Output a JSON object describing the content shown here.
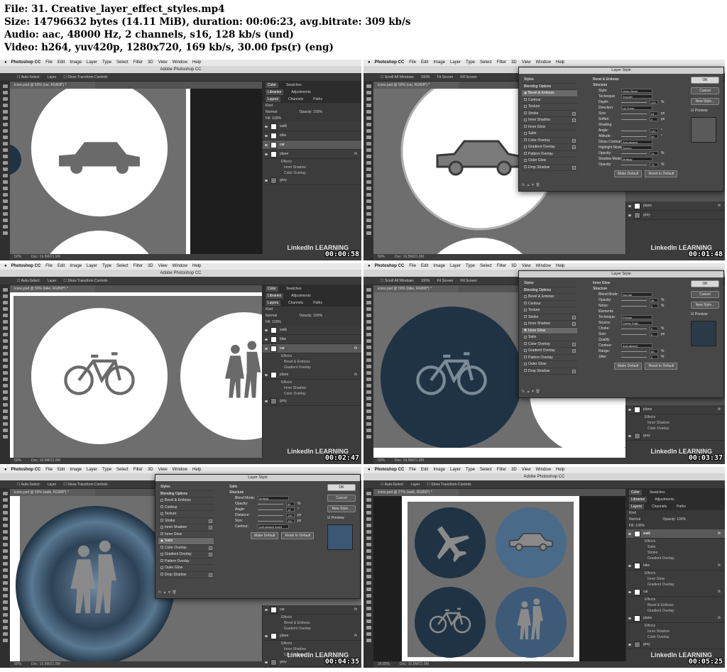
{
  "header": {
    "file": "File: 31. Creative_layer_effect_styles.mp4",
    "size": "Size: 14796632 bytes (14.11 MiB), duration: 00:06:23, avg.bitrate: 309 kb/s",
    "audio": "Audio: aac, 48000 Hz, 2 channels, s16, 128 kb/s (und)",
    "video": "Video: h264, yuv420p, 1280x720, 169 kb/s, 30.00 fps(r) (eng)"
  },
  "app": {
    "menus": [
      "Photoshop CC",
      "File",
      "Edit",
      "Image",
      "Layer",
      "Type",
      "Select",
      "Filter",
      "3D",
      "View",
      "Window",
      "Help"
    ],
    "window_title": "Adobe Photoshop CC",
    "auto_select": "Auto-Select:",
    "layer_dropdown": "Layer",
    "show_transform": "Show Transform Controls",
    "scroll_all": "Scroll All Windows",
    "fit_screen": "Fit Screen",
    "fill_screen": "Fill Screen",
    "zoom_label": "100%",
    "doc_size": "Doc: 16.5M/21.9M",
    "watermark": "LinkedIn LEARNING"
  },
  "panel": {
    "tabs_top": [
      "Color",
      "Swatches"
    ],
    "tabs_mid": [
      "Libraries",
      "Adjustments"
    ],
    "tabs_layers": [
      "Layers",
      "Channels",
      "Paths"
    ],
    "kind": "Kind",
    "blend": "Normal",
    "opacity": "Opacity: 100%",
    "fill": "Fill: 100%",
    "fx": "fx"
  },
  "frames": [
    {
      "timestamp": "00:00:58",
      "doc_tab": "icons.psd @ 50% (car, RGB/8*) *",
      "zoom": "50%",
      "layers": [
        {
          "name": "walk",
          "thumb": "white",
          "selected": false,
          "fx": false,
          "subs": []
        },
        {
          "name": "bike",
          "thumb": "white",
          "selected": false,
          "fx": false,
          "subs": []
        },
        {
          "name": "car",
          "thumb": "white",
          "selected": true,
          "fx": false,
          "subs": []
        },
        {
          "name": "plane",
          "thumb": "white",
          "selected": false,
          "fx": true,
          "subs": [
            "Effects",
            "Inner Shadow",
            "Color Overlay"
          ]
        },
        {
          "name": "grey",
          "thumb": "grey",
          "selected": false,
          "fx": false,
          "subs": []
        }
      ]
    },
    {
      "timestamp": "00:01:48",
      "doc_tab": "icons.psd @ 50% (car, RGB/8*) *",
      "zoom": "50%",
      "layers": [
        {
          "name": "plane",
          "thumb": "white",
          "selected": false,
          "fx": true,
          "subs": []
        },
        {
          "name": "grey",
          "thumb": "grey",
          "selected": false,
          "fx": false,
          "subs": []
        }
      ],
      "dialog": {
        "title": "Layer Style",
        "section": "Bevel & Emboss",
        "subsection": "Structure",
        "rows": [
          {
            "label": "Style:",
            "value": "Outer Bevel",
            "unit": ""
          },
          {
            "label": "Technique:",
            "value": "Smooth",
            "unit": ""
          },
          {
            "label": "Depth:",
            "value": "100",
            "unit": "%"
          },
          {
            "label": "Direction:",
            "value": "Up  Down",
            "unit": ""
          },
          {
            "label": "Size:",
            "value": "24",
            "unit": "px"
          },
          {
            "label": "Soften:",
            "value": "0",
            "unit": "px"
          },
          {
            "label": "Shading",
            "value": "",
            "unit": ""
          },
          {
            "label": "Angle:",
            "value": "141",
            "unit": "°"
          },
          {
            "label": "Altitude:",
            "value": "30",
            "unit": "°"
          },
          {
            "label": "Gloss Contour:",
            "value": "Anti-aliased",
            "unit": ""
          },
          {
            "label": "Highlight Mode:",
            "value": "Screen",
            "unit": ""
          },
          {
            "label": "Opacity:",
            "value": "75",
            "unit": "%"
          },
          {
            "label": "Shadow Mode:",
            "value": "Multiply",
            "unit": ""
          },
          {
            "label": "Opacity:",
            "value": "75",
            "unit": "%"
          }
        ],
        "buttons": [
          "Make Default",
          "Reset to Default"
        ],
        "side_buttons": [
          "OK",
          "Cancel",
          "New Style..."
        ],
        "preview": "Preview",
        "swatch_color": "#5a5a5a"
      }
    },
    {
      "timestamp": "00:02:47",
      "doc_tab": "icons.psd @ 50% (bike, RGB/8*) *",
      "zoom": "50%",
      "layers": [
        {
          "name": "walk",
          "thumb": "white",
          "selected": false,
          "fx": false,
          "subs": []
        },
        {
          "name": "bike",
          "thumb": "white",
          "selected": false,
          "fx": false,
          "subs": []
        },
        {
          "name": "car",
          "thumb": "white",
          "selected": true,
          "fx": true,
          "subs": [
            "Effects",
            "Bevel & Emboss",
            "Gradient Overlay"
          ]
        },
        {
          "name": "plane",
          "thumb": "white",
          "selected": false,
          "fx": true,
          "subs": [
            "Effects",
            "Inner Shadow",
            "Color Overlay"
          ]
        },
        {
          "name": "grey",
          "thumb": "grey",
          "selected": false,
          "fx": false,
          "subs": []
        }
      ]
    },
    {
      "timestamp": "00:03:37",
      "doc_tab": "icons.psd @ 50% (bike, RGB/8*) *",
      "zoom": "50%",
      "layers": [
        {
          "name": "plane",
          "thumb": "white",
          "selected": false,
          "fx": true,
          "subs": [
            "Effects",
            "Inner Shadow",
            "Color Overlay"
          ]
        },
        {
          "name": "grey",
          "thumb": "grey",
          "selected": false,
          "fx": false,
          "subs": []
        }
      ],
      "dialog": {
        "title": "Layer Style",
        "section": "Inner Glow",
        "subsection": "Structure",
        "rows": [
          {
            "label": "Blend Mode:",
            "value": "Normal",
            "unit": ""
          },
          {
            "label": "Opacity:",
            "value": "35",
            "unit": "%"
          },
          {
            "label": "Noise:",
            "value": "0",
            "unit": "%"
          },
          {
            "label": "Elements",
            "value": "",
            "unit": ""
          },
          {
            "label": "Technique:",
            "value": "Precise",
            "unit": ""
          },
          {
            "label": "Source:",
            "value": "Center  Edge",
            "unit": ""
          },
          {
            "label": "Choke:",
            "value": "0",
            "unit": "%"
          },
          {
            "label": "Size:",
            "value": "0",
            "unit": "px"
          },
          {
            "label": "Quality",
            "value": "",
            "unit": ""
          },
          {
            "label": "Contour:",
            "value": "Anti-aliased",
            "unit": ""
          },
          {
            "label": "Range:",
            "value": "50",
            "unit": "%"
          },
          {
            "label": "Jitter:",
            "value": "0",
            "unit": "%"
          }
        ],
        "buttons": [
          "Make Default",
          "Reset to Default"
        ],
        "side_buttons": [
          "OK",
          "Cancel",
          "New Style..."
        ],
        "preview": "Preview",
        "swatch_color": "#2a3a48"
      }
    },
    {
      "timestamp": "00:04:35",
      "doc_tab": "icons.psd @ 50% (walk, RGB/8*) *",
      "zoom": "50%",
      "layers": [
        {
          "name": "car",
          "thumb": "white",
          "selected": false,
          "fx": true,
          "subs": [
            "Effects",
            "Bevel & Emboss",
            "Gradient Overlay"
          ]
        },
        {
          "name": "plane",
          "thumb": "white",
          "selected": false,
          "fx": true,
          "subs": [
            "Effects",
            "Inner Shadow",
            "Color Overlay"
          ]
        },
        {
          "name": "grey",
          "thumb": "grey",
          "selected": false,
          "fx": false,
          "subs": []
        }
      ],
      "dialog": {
        "title": "Layer Style",
        "section": "Satin",
        "subsection": "Structure",
        "rows": [
          {
            "label": "Blend Mode:",
            "value": "Multiply",
            "unit": ""
          },
          {
            "label": "Opacity:",
            "value": "50",
            "unit": "%"
          },
          {
            "label": "Angle:",
            "value": "19",
            "unit": "°"
          },
          {
            "label": "Distance:",
            "value": "190",
            "unit": "px"
          },
          {
            "label": "Size:",
            "value": "250",
            "unit": "px"
          },
          {
            "label": "Contour:",
            "value": "Anti-aliased  Invert",
            "unit": ""
          }
        ],
        "buttons": [
          "Make Default",
          "Reset to Default"
        ],
        "side_buttons": [
          "OK",
          "Cancel",
          "New Style..."
        ],
        "preview": "Preview",
        "swatch_color": "#3a5874"
      }
    },
    {
      "timestamp": "00:05:25",
      "doc_tab": "icons.psd @ 27% (walk, RGB/8*) *",
      "zoom": "26.85%",
      "layers": [
        {
          "name": "walk",
          "thumb": "white",
          "selected": true,
          "fx": true,
          "subs": [
            "Effects",
            "Satin",
            "Stroke",
            "Gradient Overlay"
          ]
        },
        {
          "name": "bike",
          "thumb": "white",
          "selected": false,
          "fx": true,
          "subs": [
            "Effects",
            "Inner Glow",
            "Gradient Overlay"
          ]
        },
        {
          "name": "car",
          "thumb": "white",
          "selected": false,
          "fx": true,
          "subs": [
            "Effects",
            "Bevel & Emboss",
            "Gradient Overlay"
          ]
        },
        {
          "name": "plane",
          "thumb": "white",
          "selected": false,
          "fx": true,
          "subs": [
            "Effects",
            "Inner Shadow",
            "Color Overlay"
          ]
        },
        {
          "name": "grey",
          "thumb": "grey",
          "selected": false,
          "fx": false,
          "subs": []
        }
      ]
    }
  ],
  "style_list": [
    {
      "label": "Styles",
      "check": false,
      "plus": false,
      "head": true
    },
    {
      "label": "Blending Options",
      "check": false,
      "plus": false,
      "head": true
    },
    {
      "label": "Bevel & Emboss",
      "check": true,
      "plus": false,
      "head": false
    },
    {
      "label": "Contour",
      "check": true,
      "plus": false,
      "head": false
    },
    {
      "label": "Texture",
      "check": true,
      "plus": false,
      "head": false
    },
    {
      "label": "Stroke",
      "check": true,
      "plus": true,
      "head": false
    },
    {
      "label": "Inner Shadow",
      "check": true,
      "plus": true,
      "head": false
    },
    {
      "label": "Inner Glow",
      "check": true,
      "plus": false,
      "head": false
    },
    {
      "label": "Satin",
      "check": true,
      "plus": false,
      "head": false
    },
    {
      "label": "Color Overlay",
      "check": true,
      "plus": true,
      "head": false
    },
    {
      "label": "Gradient Overlay",
      "check": true,
      "plus": true,
      "head": false
    },
    {
      "label": "Pattern Overlay",
      "check": true,
      "plus": false,
      "head": false
    },
    {
      "label": "Outer Glow",
      "check": true,
      "plus": false,
      "head": false
    },
    {
      "label": "Drop Shadow",
      "check": true,
      "plus": true,
      "head": false
    }
  ],
  "colors": {
    "canvas_grey": "#6e6e6e",
    "circle_white": "#ffffff",
    "icon_grey": "#6a6a6a",
    "dark_teal": "#1f3344",
    "satin_blue": "#4a6a8a"
  }
}
